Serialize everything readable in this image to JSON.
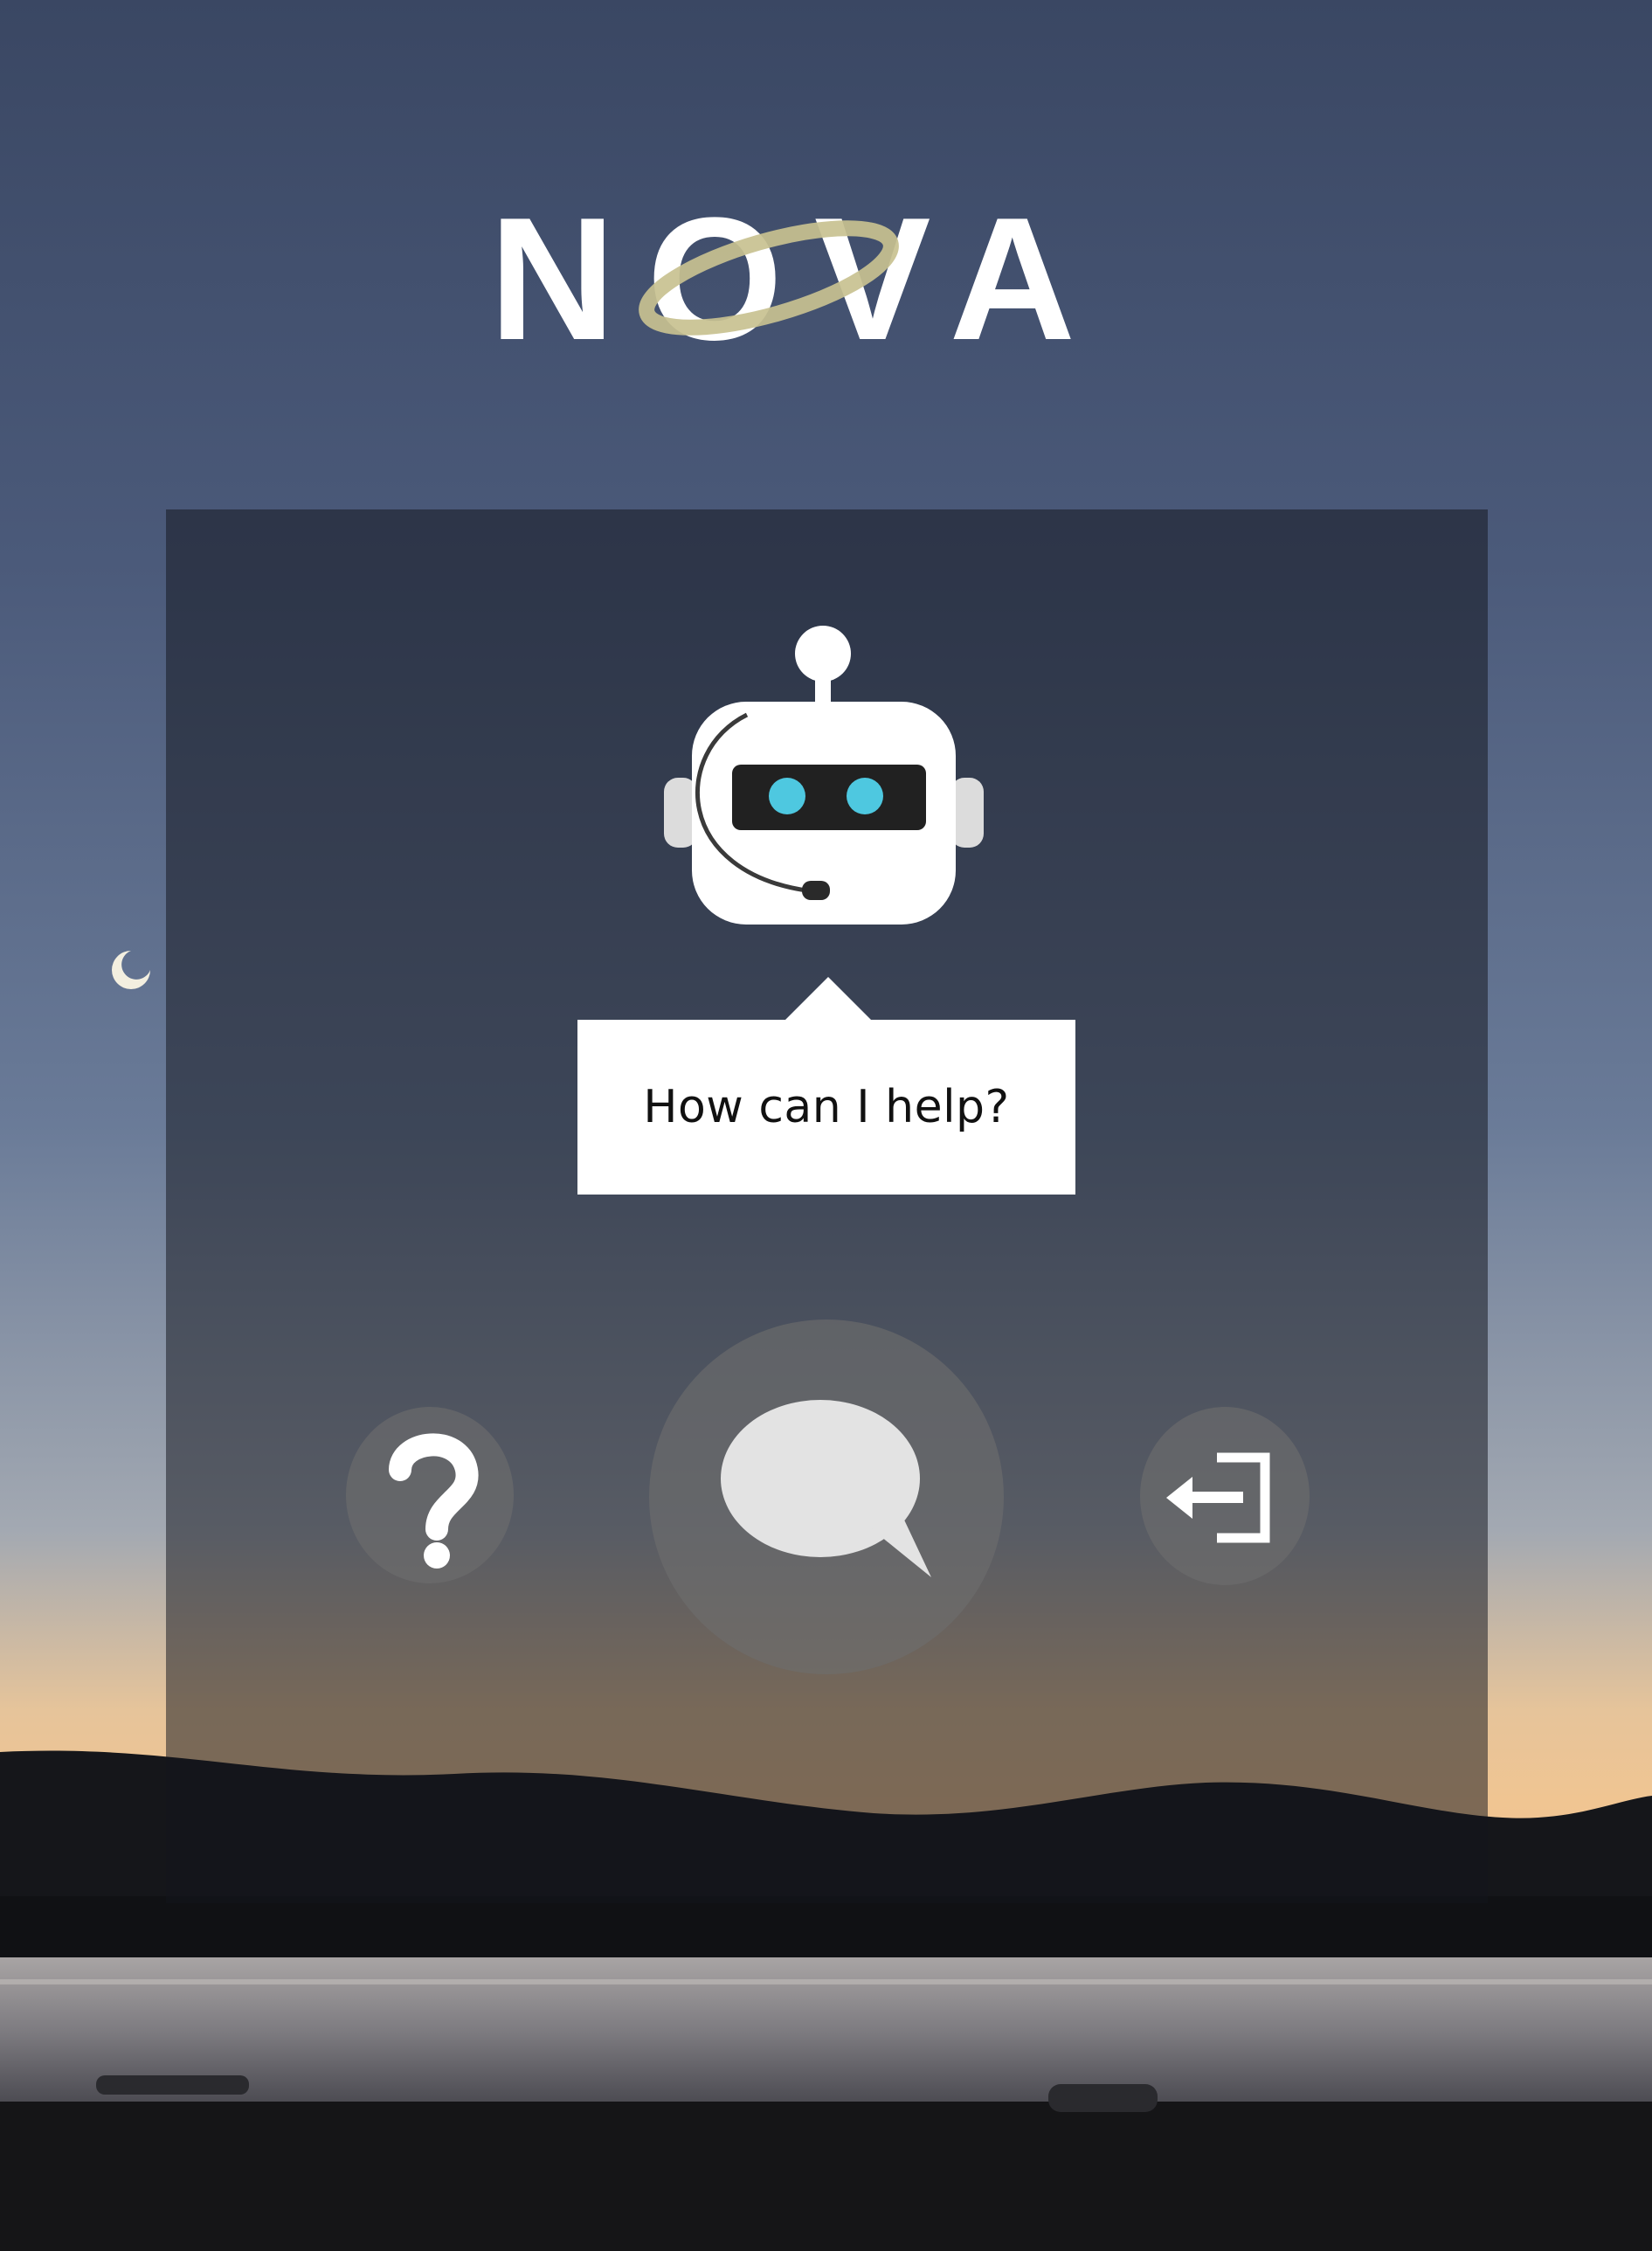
{
  "app": {
    "logo_text": "NOVA",
    "colors": {
      "accent_ring": "#c8c190",
      "panel_overlay": "rgba(20,22,28,0.52)",
      "button_fill": "#6e6e6e",
      "robot_eye": "#4ec8e0"
    }
  },
  "assistant": {
    "greeting": "How can I help?",
    "avatar_icon": "robot-headset-icon"
  },
  "actions": {
    "help_icon": "question-mark-icon",
    "chat_icon": "speech-bubble-icon",
    "logout_icon": "exit-door-icon"
  }
}
